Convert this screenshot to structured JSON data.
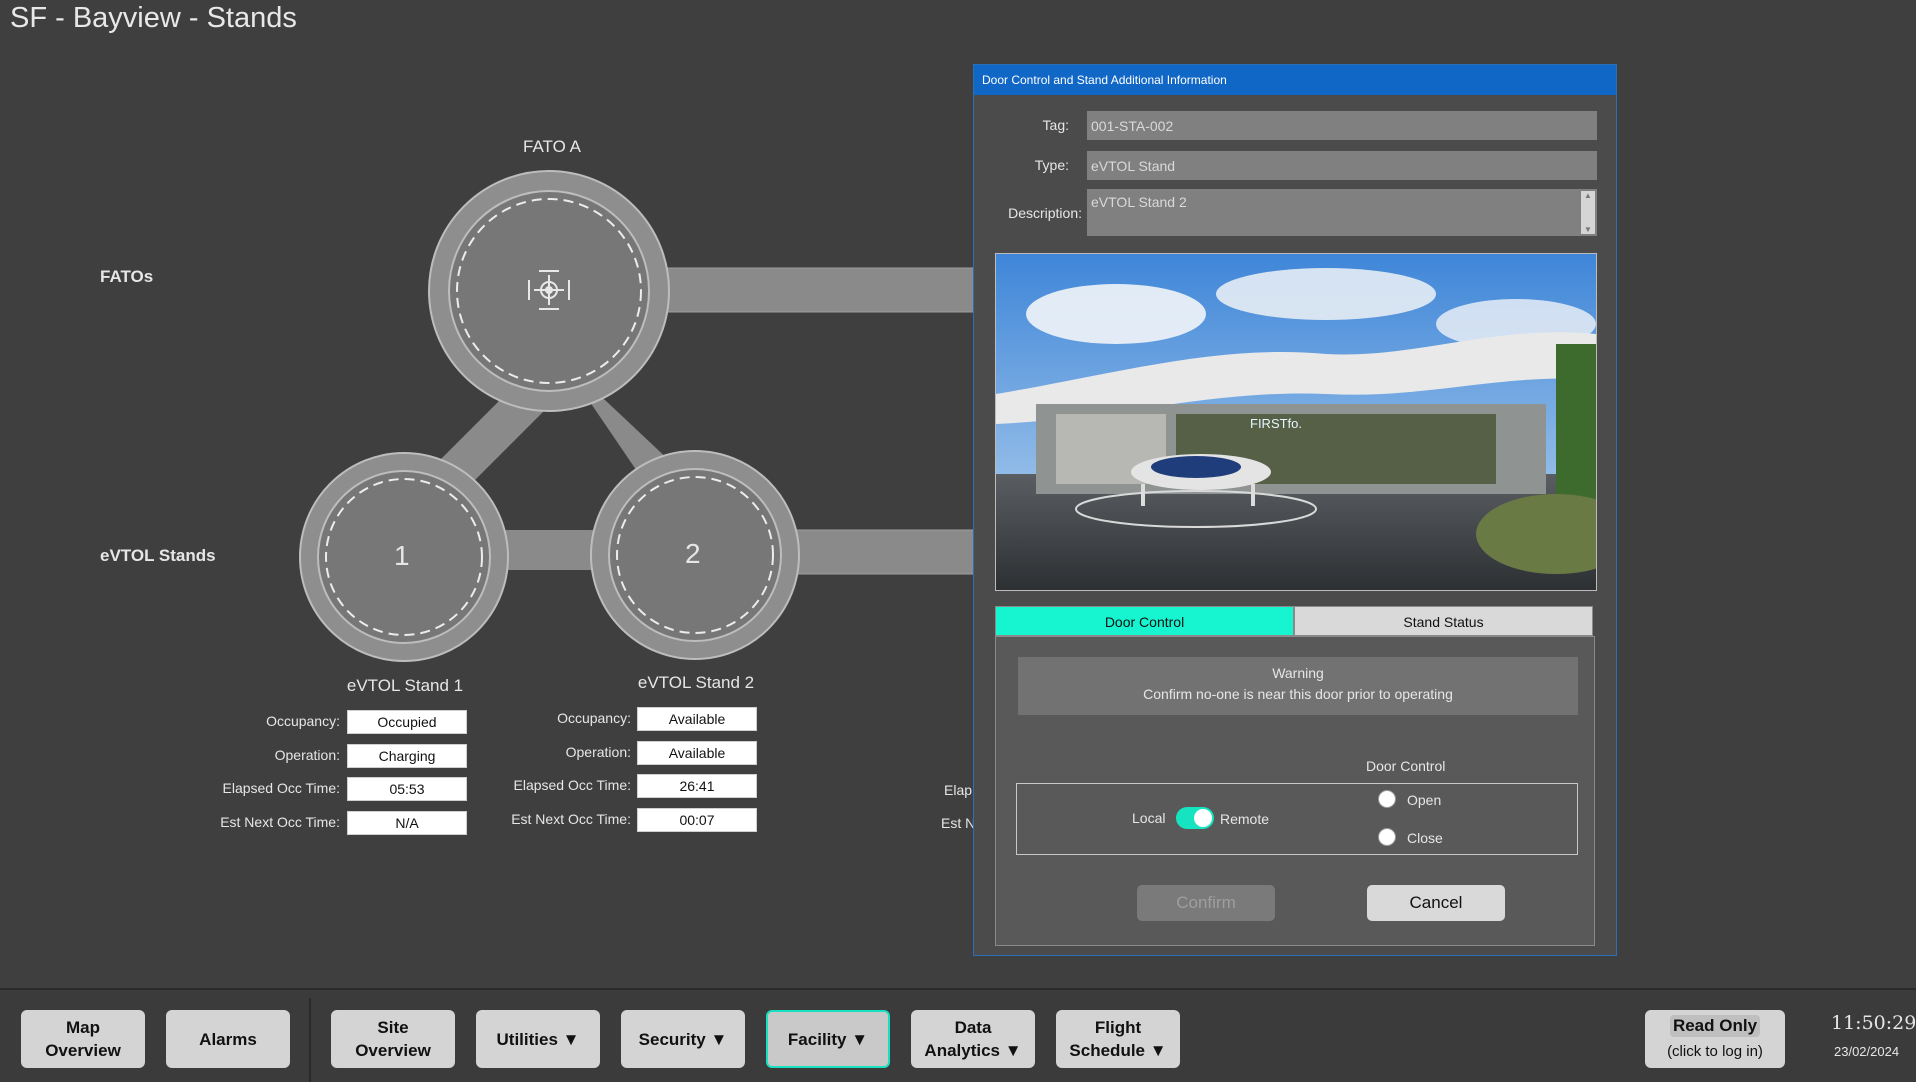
{
  "page": {
    "title": "SF - Bayview - Stands"
  },
  "diagram": {
    "row_fatos": "FATOs",
    "row_stands": "eVTOL Stands",
    "fato_a": "FATO A",
    "stand1_number": "1",
    "stand2_number": "2"
  },
  "stands": [
    {
      "title": "eVTOL Stand 1",
      "occupancy_label": "Occupancy:",
      "occupancy": "Occupied",
      "operation_label": "Operation:",
      "operation": "Charging",
      "elapsed_label": "Elapsed Occ Time:",
      "elapsed": "05:53",
      "next_label": "Est Next Occ Time:",
      "next": "N/A"
    },
    {
      "title": "eVTOL Stand 2",
      "occupancy_label": "Occupancy:",
      "occupancy": "Available",
      "operation_label": "Operation:",
      "operation": "Available",
      "elapsed_label": "Elapsed Occ Time:",
      "elapsed": "26:41",
      "next_label": "Est Next Occ Time:",
      "next": "00:07"
    }
  ],
  "stand3_partial": {
    "elapsed_label_fragment": "Elap",
    "next_label_fragment": "Est N"
  },
  "dialog": {
    "title": "Door Control and Stand Additional Information",
    "tag_label": "Tag:",
    "tag": "001-STA-002",
    "type_label": "Type:",
    "type": "eVTOL Stand",
    "description_label": "Description:",
    "description": "eVTOL Stand 2",
    "image_sign": "FIRSTfo.",
    "tabs": {
      "door_control": "Door Control",
      "stand_status": "Stand Status",
      "active": "door_control"
    },
    "warning_title": "Warning",
    "warning_text": "Confirm no-one is near this door prior to operating",
    "door_control_heading": "Door Control",
    "local_label": "Local",
    "remote_label": "Remote",
    "mode_toggle_on": true,
    "open_label": "Open",
    "close_label": "Close",
    "confirm_label": "Confirm",
    "cancel_label": "Cancel"
  },
  "nav": {
    "map_overview": [
      "Map",
      "Overview"
    ],
    "alarms": "Alarms",
    "site_overview": [
      "Site",
      "Overview"
    ],
    "utilities": "Utilities ▼",
    "security": "Security ▼",
    "facility": "Facility ▼",
    "data_analytics": [
      "Data",
      "Analytics ▼"
    ],
    "flight_schedule": [
      "Flight",
      "Schedule ▼"
    ],
    "readonly_title": "Read Only",
    "readonly_sub": "(click to log in)",
    "time": "11:50:29",
    "date": "23/02/2024"
  },
  "colors": {
    "accent": "#16f5cf",
    "dialog_titlebar": "#1167c6",
    "background": "#3f3f3f"
  }
}
